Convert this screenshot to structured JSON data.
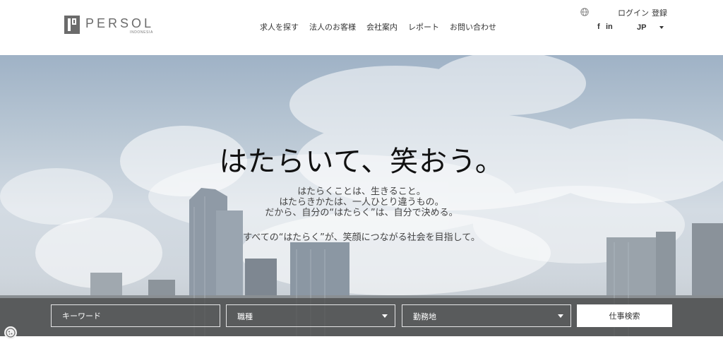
{
  "logo": {
    "word": "PERSOL",
    "sub": "INDONESIA"
  },
  "nav": {
    "items": [
      "求人を探す",
      "法人のお客様",
      "会社案内",
      "レポート",
      "お問い合わせ"
    ]
  },
  "account": {
    "login": "ログイン",
    "register": "登録"
  },
  "social": {
    "facebook": "f",
    "linkedin": "in"
  },
  "language": {
    "selected": "JP"
  },
  "hero": {
    "headline": "はたらいて、笑おう。",
    "lead_lines": [
      "はたらくことは、生きること。",
      "はたらきかたは、一人ひとり違うもの。",
      "だから、自分の“はたらく”は、自分で決める。"
    ],
    "tagline": "すべての“はたらく”が、笑顔につながる社会を目指して。"
  },
  "search": {
    "keyword_placeholder": "キーワード",
    "occupation_label": "職種",
    "location_label": "勤務地",
    "button_label": "仕事検索"
  },
  "icons": {
    "globe": "globe-icon",
    "caret": "chevron-down-icon",
    "cookie": "cookie-icon"
  }
}
